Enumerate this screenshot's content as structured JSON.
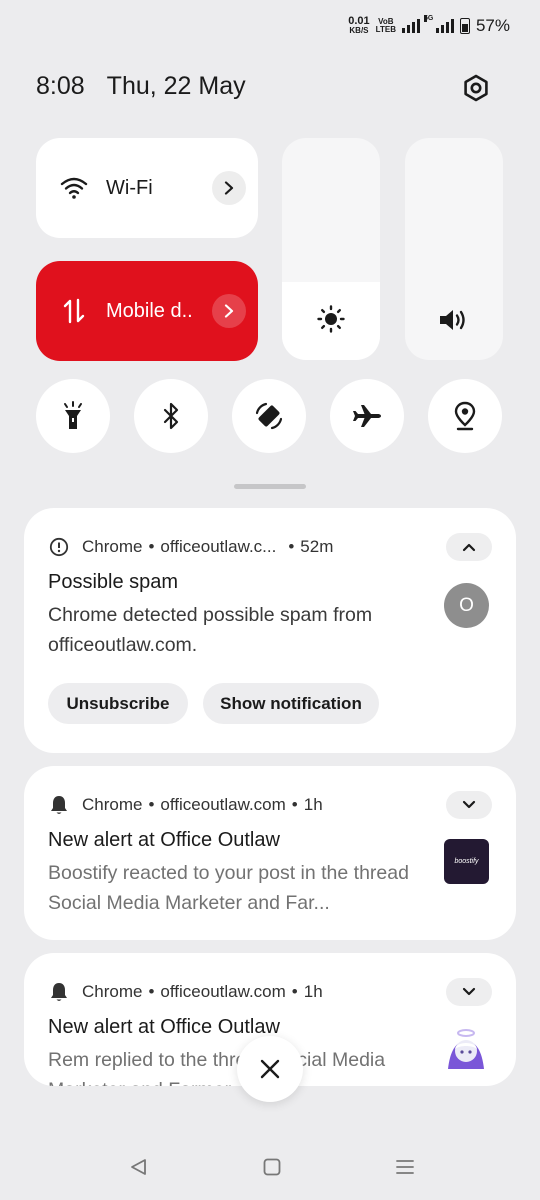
{
  "status_bar": {
    "net_speed_value": "0.01",
    "net_speed_unit": "KB/S",
    "volte_top": "VoB",
    "volte_bottom": "LTEB",
    "network_tag": "5G",
    "battery_percent": "57%",
    "battery_level": 0.57
  },
  "header": {
    "time": "8:08",
    "date": "Thu, 22 May",
    "settings_icon": "settings-hexagon-icon"
  },
  "quick_settings": {
    "wifi": {
      "label": "Wi-Fi",
      "icon": "wifi-icon",
      "active": false
    },
    "mobile_data": {
      "label": "Mobile d..",
      "icon": "mobile-data-icon",
      "active": true,
      "accent": "#e0111d"
    },
    "brightness": {
      "icon": "brightness-icon",
      "level": 0.35
    },
    "volume": {
      "icon": "volume-icon",
      "level": 0.0
    },
    "toggles": [
      {
        "name": "flashlight",
        "icon": "flashlight-icon"
      },
      {
        "name": "bluetooth",
        "icon": "bluetooth-icon"
      },
      {
        "name": "auto-rotate",
        "icon": "auto-rotate-icon"
      },
      {
        "name": "airplane-mode",
        "icon": "airplane-icon"
      },
      {
        "name": "location",
        "icon": "location-icon"
      }
    ]
  },
  "notifications": [
    {
      "app": "Chrome",
      "source": "officeoutlaw.c...",
      "time": "52m",
      "icon": "alert-circle-icon",
      "title": "Possible spam",
      "body": "Chrome detected possible spam from officeoutlaw.com.",
      "avatar_letter": "O",
      "actions": [
        "Unsubscribe",
        "Show notification"
      ],
      "expanded": true
    },
    {
      "app": "Chrome",
      "source": "officeoutlaw.com",
      "time": "1h",
      "icon": "bell-icon",
      "title": "New alert at Office Outlaw",
      "body": "Boostify reacted to your post in the thread Social Media Marketer and Far...",
      "thumbnail_text": "boostify",
      "expanded": false
    },
    {
      "app": "Chrome",
      "source": "officeoutlaw.com",
      "time": "1h",
      "icon": "bell-icon",
      "title": "New alert at Office Outlaw",
      "body": "Rem replied to the thread Social Media Marketer and Farmer ...",
      "expanded": false
    }
  ],
  "dismiss_all": {
    "icon": "close-icon"
  },
  "nav_bar": {
    "back": "back-icon",
    "home": "home-icon",
    "recents": "recents-icon"
  }
}
